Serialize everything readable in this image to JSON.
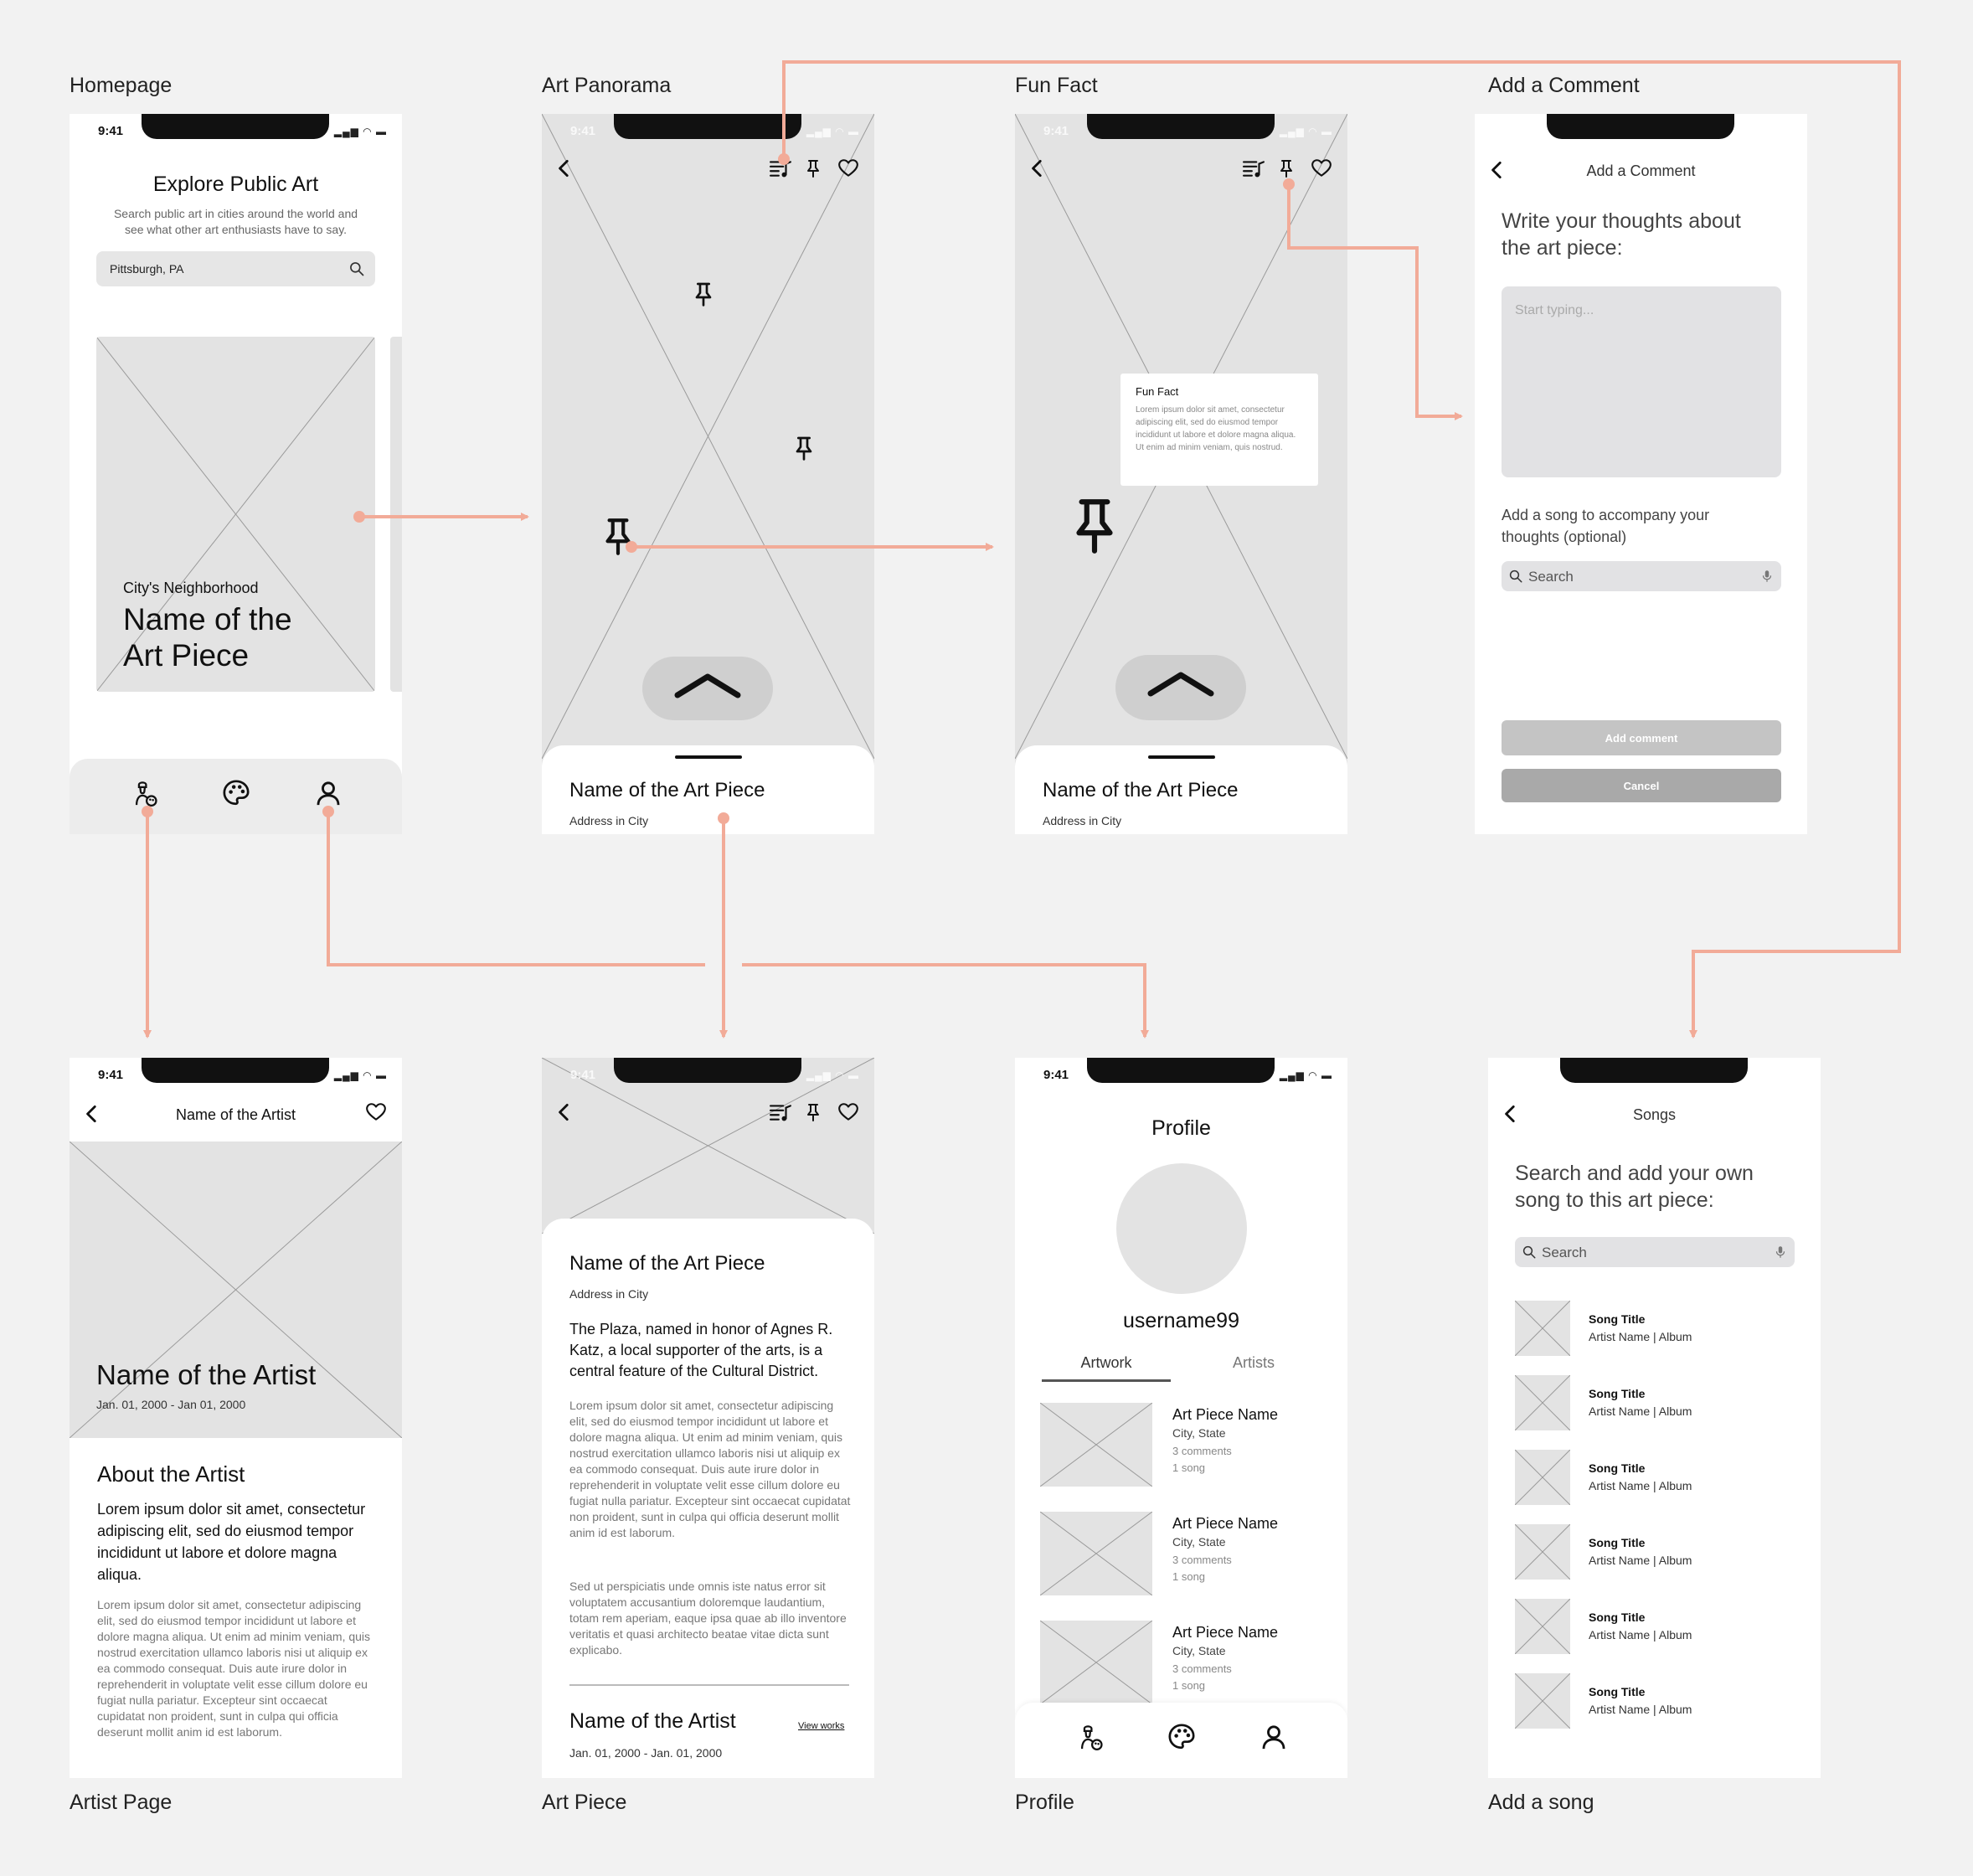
{
  "labels": {
    "homepage": "Homepage",
    "art_panorama": "Art Panorama",
    "fun_fact": "Fun Fact",
    "add_comment": "Add a Comment",
    "artist_page": "Artist Page",
    "art_piece": "Art Piece",
    "profile": "Profile",
    "add_song": "Add a song"
  },
  "status_time": "9:41",
  "status_icons": "▂▄▆ ◠ ▬",
  "colors": {
    "background": "#f2f2f2",
    "flow_arrow": "#f2ab98",
    "placeholder": "#e3e3e3",
    "button_light": "#c4c4c4",
    "button_dark": "#a9a9a9"
  },
  "icons": {
    "back": "chevron-left-icon",
    "playlist": "playlist-music-icon",
    "pin": "pushpin-icon",
    "heart": "heart-icon",
    "search": "magnifier-icon",
    "mic": "microphone-icon",
    "nav_artist": "artist-icon",
    "nav_palette": "palette-icon",
    "nav_profile": "person-icon",
    "expand": "chevron-up-icon"
  },
  "homepage": {
    "title": "Explore Public Art",
    "subtitle": "Search public art in cities around the world and see what other art enthusiasts have to say.",
    "search_value": "Pittsburgh, PA",
    "card_kicker": "City's Neighborhood",
    "card_title": "Name of the Art Piece"
  },
  "panorama": {
    "piece_name": "Name of the Art Piece",
    "address": "Address in City"
  },
  "fun_fact": {
    "heading": "Fun Fact",
    "body": "Lorem ipsum dolor sit amet, consectetur adipiscing elit, sed do eiusmod tempor incididunt ut labore et dolore magna aliqua. Ut enim ad minim veniam, quis nostrud.",
    "piece_name": "Name of the Art Piece",
    "address": "Address in City"
  },
  "add_comment": {
    "header": "Add a Comment",
    "prompt": "Write your thoughts about the art piece:",
    "textarea_placeholder": "Start typing...",
    "song_prompt": "Add a song to accompany your thoughts (optional)",
    "search_placeholder": "Search",
    "submit_label": "Add comment",
    "cancel_label": "Cancel"
  },
  "artist_page": {
    "header": "Name of the Artist",
    "hero_name": "Name of the Artist",
    "dates": "Jan. 01, 2000 - Jan 01, 2000",
    "about_heading": "About the Artist",
    "lead": "Lorem ipsum dolor sit amet, consectetur adipiscing elit, sed do eiusmod tempor incididunt ut labore et dolore magna aliqua.",
    "body": "Lorem ipsum dolor sit amet, consectetur adipiscing elit, sed do eiusmod tempor incididunt ut labore et dolore magna aliqua. Ut enim ad minim veniam, quis nostrud exercitation ullamco laboris nisi ut aliquip ex ea commodo consequat. Duis aute irure dolor in reprehenderit in voluptate velit esse cillum dolore eu fugiat nulla pariatur. Excepteur sint occaecat cupidatat non proident, sunt in culpa qui officia deserunt mollit anim id est laborum."
  },
  "art_piece": {
    "piece_name": "Name of the Art Piece",
    "address": "Address in City",
    "lead": "The Plaza, named in honor of Agnes R. Katz, a local supporter of the arts, is a central feature of the Cultural District.",
    "body1": "Lorem ipsum dolor sit amet, consectetur adipiscing elit, sed do eiusmod tempor incididunt ut labore et dolore magna aliqua. Ut enim ad minim veniam, quis nostrud exercitation ullamco laboris nisi ut aliquip ex ea commodo consequat. Duis aute irure dolor in reprehenderit in voluptate velit esse cillum dolore eu fugiat nulla pariatur. Excepteur sint occaecat cupidatat non proident, sunt in culpa qui officia deserunt mollit anim id est laborum.",
    "body2": "Sed ut perspiciatis unde omnis iste natus error sit voluptatem accusantium doloremque laudantium, totam rem aperiam, eaque ipsa quae ab illo inventore veritatis et quasi architecto beatae vitae dicta sunt explicabo.",
    "artist_name": "Name of the Artist",
    "view_works": "View works",
    "artist_dates": "Jan. 01, 2000 - Jan. 01, 2000"
  },
  "profile": {
    "title": "Profile",
    "username": "username99",
    "tab_artwork": "Artwork",
    "tab_artists": "Artists",
    "items": [
      {
        "name": "Art Piece Name",
        "location": "City, State",
        "comments": "3 comments",
        "songs": "1 song"
      },
      {
        "name": "Art Piece Name",
        "location": "City, State",
        "comments": "3 comments",
        "songs": "1 song"
      },
      {
        "name": "Art Piece Name",
        "location": "City, State",
        "comments": "3 comments",
        "songs": "1 song"
      }
    ]
  },
  "songs": {
    "header": "Songs",
    "prompt": "Search and add your own song to this art piece:",
    "search_placeholder": "Search",
    "items": [
      {
        "title": "Song Title",
        "meta": "Artist Name | Album"
      },
      {
        "title": "Song Title",
        "meta": "Artist Name | Album"
      },
      {
        "title": "Song Title",
        "meta": "Artist Name | Album"
      },
      {
        "title": "Song Title",
        "meta": "Artist Name | Album"
      },
      {
        "title": "Song Title",
        "meta": "Artist Name | Album"
      },
      {
        "title": "Song Title",
        "meta": "Artist Name | Album"
      }
    ]
  }
}
